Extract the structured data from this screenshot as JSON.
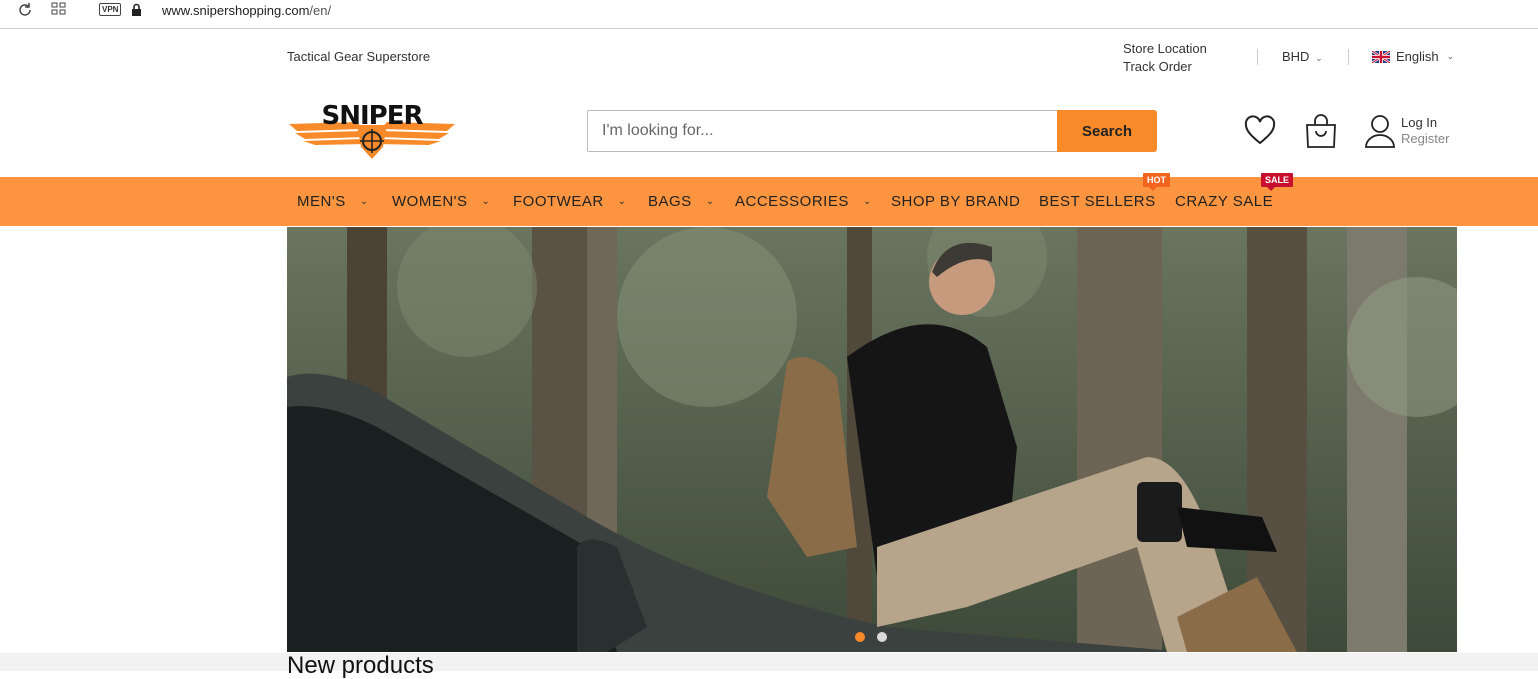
{
  "browser": {
    "url_host": "www.snipershopping.com",
    "url_path": "/en/",
    "vpn_label": "VPN"
  },
  "topbar": {
    "tagline": "Tactical Gear Superstore",
    "store_location": "Store Location",
    "track_order": "Track Order",
    "currency": "BHD",
    "language": "English"
  },
  "header": {
    "logo_text": "SNIPER",
    "search_placeholder": "I'm looking for...",
    "search_button": "Search",
    "login": "Log In",
    "register": "Register"
  },
  "nav": {
    "items": [
      {
        "label": "MEN'S"
      },
      {
        "label": "WOMEN'S"
      },
      {
        "label": "FOOTWEAR"
      },
      {
        "label": "BAGS"
      },
      {
        "label": "ACCESSORIES"
      },
      {
        "label": "SHOP BY BRAND"
      },
      {
        "label": "BEST SELLERS",
        "badge": "HOT"
      },
      {
        "label": "CRAZY SALE",
        "badge": "SALE"
      }
    ]
  },
  "hero": {
    "slide_count": 2,
    "active_slide": 1
  },
  "sections": {
    "new_products_title": "New products"
  },
  "colors": {
    "accent": "#f98a2a",
    "nav_bg": "#fc9440",
    "hot_badge": "#f3641e",
    "sale_badge": "#c8102e"
  }
}
